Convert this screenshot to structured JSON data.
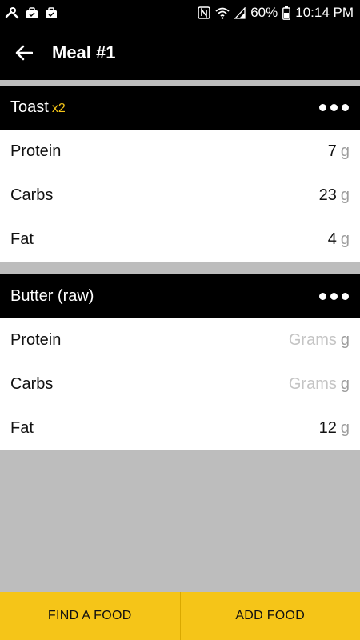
{
  "status_bar": {
    "battery": "60%",
    "time": "10:14 PM",
    "icons": [
      "tools-icon",
      "briefcase-icon",
      "briefcase-icon",
      "nfc-icon",
      "wifi-icon",
      "signal-icon",
      "battery-icon"
    ]
  },
  "app_bar": {
    "title": "Meal #1"
  },
  "foods": [
    {
      "name": "Toast",
      "multiplier": "x2",
      "nutrients": [
        {
          "label": "Protein",
          "value": "7",
          "unit": "g"
        },
        {
          "label": "Carbs",
          "value": "23",
          "unit": "g"
        },
        {
          "label": "Fat",
          "value": "4",
          "unit": "g"
        }
      ]
    },
    {
      "name": "Butter (raw)",
      "multiplier": "",
      "nutrients": [
        {
          "label": "Protein",
          "value": "",
          "placeholder": "Grams",
          "unit": "g"
        },
        {
          "label": "Carbs",
          "value": "",
          "placeholder": "Grams",
          "unit": "g"
        },
        {
          "label": "Fat",
          "value": "12",
          "unit": "g"
        }
      ]
    }
  ],
  "bottom_bar": {
    "find_label": "FIND A FOOD",
    "add_label": "ADD FOOD"
  },
  "colors": {
    "accent": "#f5c518",
    "header": "#000000",
    "background": "#bdbdbd"
  }
}
